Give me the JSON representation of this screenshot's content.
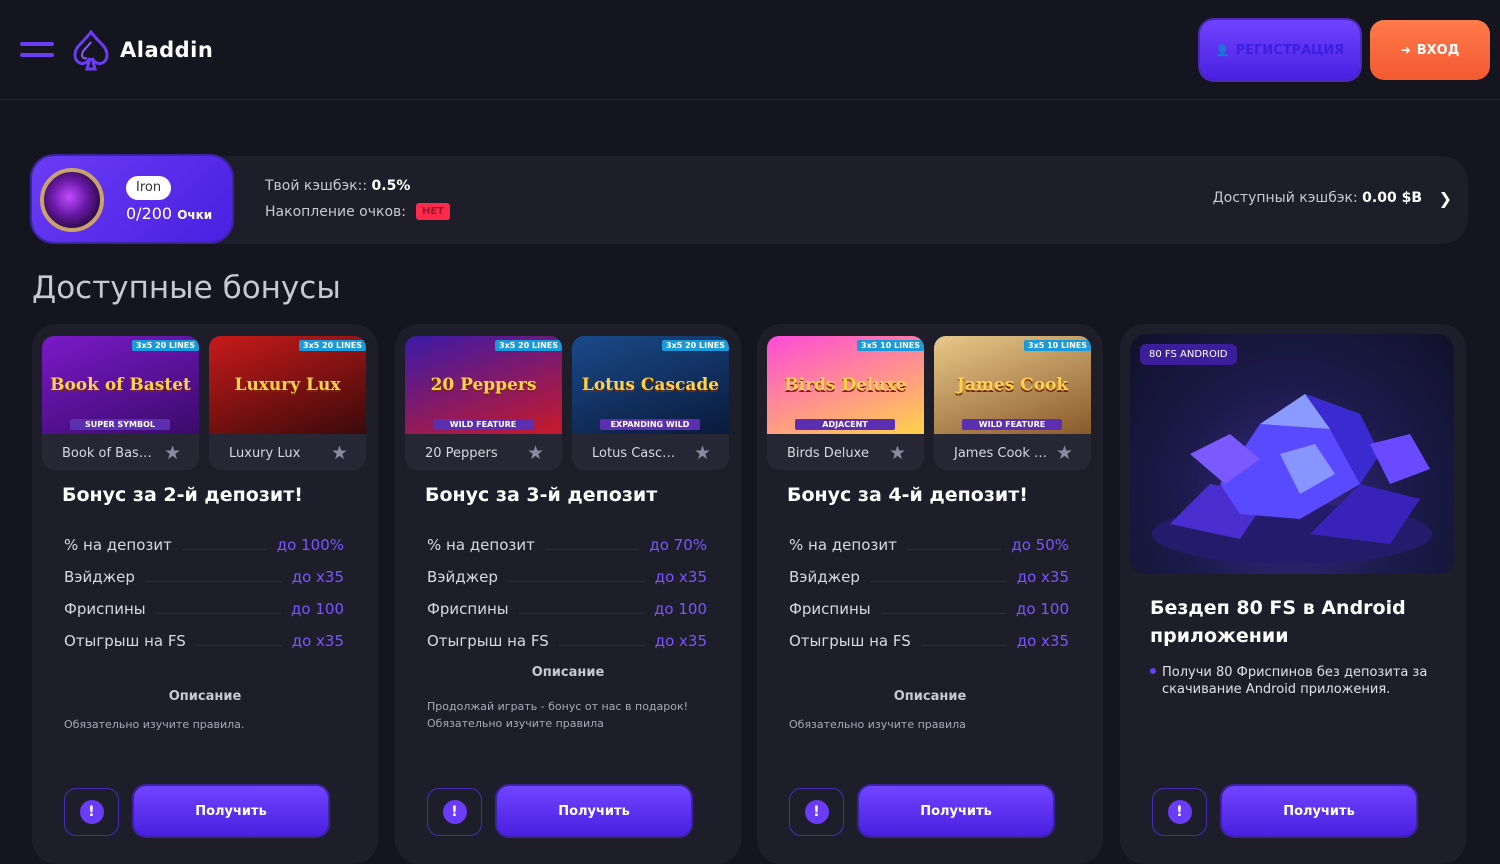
{
  "header": {
    "brand": "Aladdin",
    "register_label": "РЕГИСТРАЦИЯ",
    "login_label": "ВХОД",
    "colors": {
      "accent": "#6a3cf5",
      "login": "#f35a31",
      "bg": "#15151f"
    }
  },
  "cashback": {
    "level_name": "Iron",
    "points": "0/200",
    "points_unit": "Очки",
    "rate_label": "Твой кэшбэк::",
    "rate_value": "0.5%",
    "accum_label": "Накопление очков:",
    "accum_value": "НЕТ",
    "available_label": "Доступный кэшбэк:",
    "available_value": "0.00 $B"
  },
  "section_title": "Доступные бонусы",
  "bonuses": [
    {
      "games": [
        {
          "name": "Book of Bas…",
          "art": "Book of Bastet",
          "tag": "3x5 20 LINES",
          "feature": "SUPER SYMBOL"
        },
        {
          "name": "Luxury Lux",
          "art": "Luxury Lux",
          "tag": "3x5 20 LINES",
          "feature": ""
        }
      ],
      "title": "Бонус за 2-й депозит!",
      "rows": [
        {
          "k": "% на депозит",
          "v": "до 100%"
        },
        {
          "k": "Вэйджер",
          "v": "до x35"
        },
        {
          "k": "Фриспины",
          "v": "до 100"
        },
        {
          "k": "Отыгрыш на FS",
          "v": "до x35"
        }
      ],
      "desc_title": "Описание",
      "desc": "Обязательно изучите правила.",
      "button": "Получить",
      "info": "!"
    },
    {
      "games": [
        {
          "name": "20 Peppers",
          "art": "20 Peppers",
          "tag": "3x5 20 LINES",
          "feature": "WILD FEATURE"
        },
        {
          "name": "Lotus Casc…",
          "art": "Lotus Cascade",
          "tag": "3x5 20 LINES",
          "feature": "EXPANDING WILD"
        }
      ],
      "title": "Бонус за 3-й депозит",
      "rows": [
        {
          "k": "% на депозит",
          "v": "до 70%"
        },
        {
          "k": "Вэйджер",
          "v": "до x35"
        },
        {
          "k": "Фриспины",
          "v": "до 100"
        },
        {
          "k": "Отыгрыш на FS",
          "v": "до x35"
        }
      ],
      "desc_title": "Описание",
      "desc": "Продолжай играть - бонус от нас в подарок! Обязательно изучите правила",
      "button": "Получить",
      "info": "!"
    },
    {
      "games": [
        {
          "name": "Birds Deluxe",
          "art": "Birds Deluxe",
          "tag": "3x5 10 LINES",
          "feature": "ADJACENT"
        },
        {
          "name": "James Cook …",
          "art": "James Cook",
          "tag": "3x5 10 LINES",
          "feature": "WILD FEATURE"
        }
      ],
      "title": "Бонус за 4-й депозит!",
      "rows": [
        {
          "k": "% на депозит",
          "v": "до 50%"
        },
        {
          "k": "Вэйджер",
          "v": "до x35"
        },
        {
          "k": "Фриспины",
          "v": "до 100"
        },
        {
          "k": "Отыгрыш на FS",
          "v": "до x35"
        }
      ],
      "desc_title": "Описание",
      "desc": "Обязательно изучите правила",
      "button": "Получить",
      "info": "!"
    }
  ],
  "promo": {
    "badge": "80 FS ANDROID",
    "title": "Бездеп 80 FS в Android приложении",
    "text": "Получи 80 Фриспинов без депозита за скачивание Android приложения.",
    "button": "Получить",
    "info": "!"
  }
}
